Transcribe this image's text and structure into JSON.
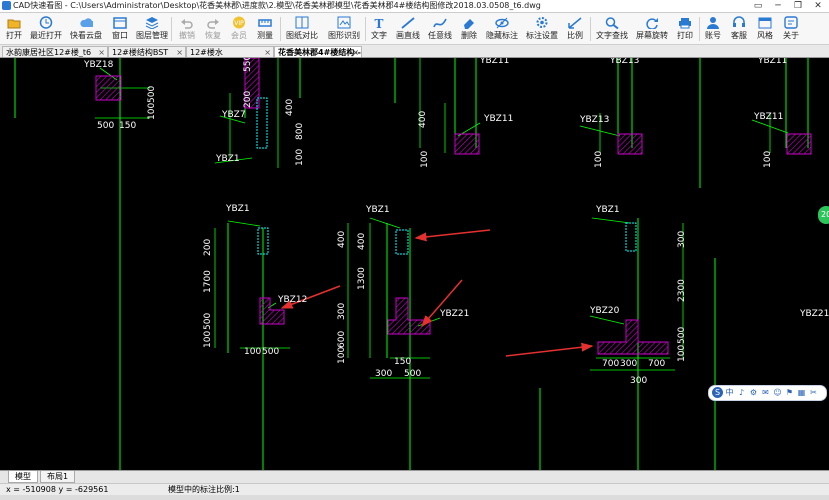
{
  "window": {
    "title": "CAD快速看图 - C:\\Users\\Administrator\\Desktop\\花香美林郡\\进度款\\2.模型\\花香美林郡模型\\花香美林郡4#楼结构图修改2018.03.0508_t6.dwg",
    "controls": [
      "▭",
      "─",
      "❐",
      "✕"
    ]
  },
  "toolbar": {
    "buttons": [
      {
        "label": "打开",
        "icon": "folder-icon",
        "enabled": true
      },
      {
        "label": "最近打开",
        "icon": "recent-icon",
        "enabled": true
      },
      {
        "label": "快看云盘",
        "icon": "cloud-icon",
        "enabled": true
      },
      {
        "label": "窗口",
        "icon": "window-icon",
        "enabled": true
      },
      {
        "label": "图层管理",
        "icon": "layers-icon",
        "enabled": true
      },
      {
        "label": "撤销",
        "icon": "undo-icon",
        "enabled": false
      },
      {
        "label": "恢复",
        "icon": "redo-icon",
        "enabled": false
      },
      {
        "label": "会员",
        "icon": "vip-icon",
        "enabled": false
      },
      {
        "label": "测量",
        "icon": "measure-icon",
        "enabled": true
      },
      {
        "label": "图纸对比",
        "icon": "compare-icon",
        "enabled": true
      },
      {
        "label": "图形识别",
        "icon": "recognize-icon",
        "enabled": true
      },
      {
        "label": "文字",
        "icon": "text-icon",
        "enabled": true
      },
      {
        "label": "画直线",
        "icon": "line-icon",
        "enabled": true
      },
      {
        "label": "任意线",
        "icon": "freeline-icon",
        "enabled": true
      },
      {
        "label": "删除",
        "icon": "eraser-icon",
        "enabled": true
      },
      {
        "label": "隐藏标注",
        "icon": "hide-icon",
        "enabled": true
      },
      {
        "label": "标注设置",
        "icon": "settings-icon",
        "enabled": true
      },
      {
        "label": "比例",
        "icon": "scale-icon",
        "enabled": true
      },
      {
        "label": "文字查找",
        "icon": "find-icon",
        "enabled": true
      },
      {
        "label": "屏幕旋转",
        "icon": "rotate-icon",
        "enabled": true
      },
      {
        "label": "打印",
        "icon": "print-icon",
        "enabled": true
      },
      {
        "label": "账号",
        "icon": "account-icon",
        "enabled": true
      },
      {
        "label": "客服",
        "icon": "support-icon",
        "enabled": true
      },
      {
        "label": "风格",
        "icon": "style-icon",
        "enabled": true
      },
      {
        "label": "关于",
        "icon": "about-icon",
        "enabled": true
      }
    ]
  },
  "file_tabs": [
    {
      "label": "水韵康居社区12#楼_t6",
      "active": false
    },
    {
      "label": "12#楼结构BST",
      "active": false
    },
    {
      "label": "12#楼水",
      "active": false
    },
    {
      "label": "花香美林郡4#楼结构--",
      "active": true
    }
  ],
  "drawing": {
    "labels": [
      "YBZ18",
      "YBZ7",
      "YBZ1",
      "YBZ1",
      "YBZ1",
      "YBZ11",
      "YBZ11",
      "YBZ13",
      "YBZ13",
      "YBZ11",
      "YBZ11",
      "YBZ1",
      "YBZ12",
      "YBZ21",
      "YBZ20",
      "YBZ21"
    ],
    "horizontal_dims": [
      "500",
      "150",
      "100",
      "500",
      "150",
      "300",
      "500",
      "700",
      "300",
      "700",
      "300"
    ],
    "vertical_dims": [
      "500",
      "100",
      "550",
      "200",
      "400",
      "800",
      "100",
      "100",
      "400",
      "200",
      "1700",
      "500",
      "100",
      "400",
      "1300",
      "300",
      "600",
      "100",
      "300",
      "2300",
      "500",
      "100",
      "400",
      "100",
      "100"
    ]
  },
  "float_toolbar": {
    "icons": [
      "中",
      "♪",
      "⚙",
      "✉",
      "☺",
      "⚑",
      "▦",
      "✂",
      "⚃"
    ]
  },
  "side_button": "20",
  "layout_tabs": [
    {
      "label": "模型",
      "active": true
    },
    {
      "label": "布局1",
      "active": false
    }
  ],
  "status": {
    "coordinates": "x = -510908  y = -629561",
    "scale_text": "模型中的标注比例:1"
  },
  "colors": {
    "canvas": "#000000",
    "wall_line": "#00ff00",
    "hatch": "#cc00cc",
    "arrow": "#e53030",
    "text": "#ffffff",
    "rebar": "#00ffff"
  }
}
